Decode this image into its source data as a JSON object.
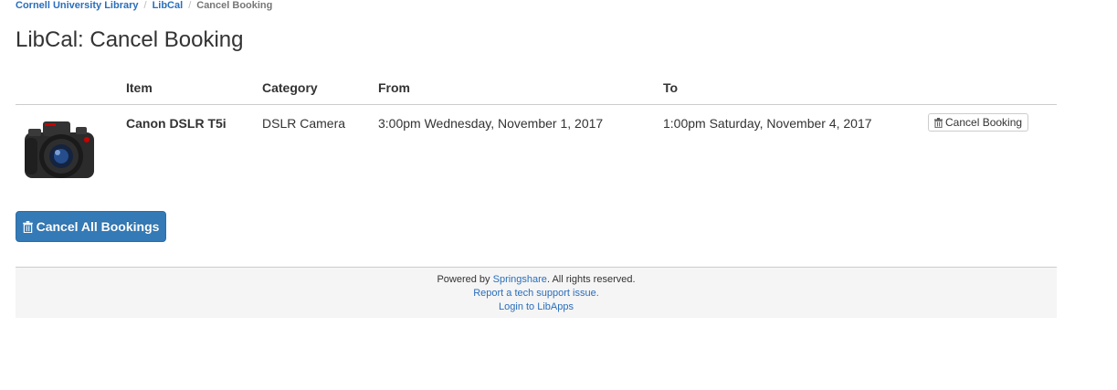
{
  "breadcrumb": {
    "items": [
      "Cornell University Library",
      "LibCal"
    ],
    "current": "Cancel Booking"
  },
  "page_title": "LibCal: Cancel Booking",
  "table": {
    "headers": {
      "item": "Item",
      "category": "Category",
      "from": "From",
      "to": "To"
    },
    "rows": [
      {
        "image": "camera-image",
        "item": "Canon DSLR T5i",
        "category": "DSLR Camera",
        "from": "3:00pm Wednesday, November 1, 2017",
        "to": "1:00pm Saturday, November 4, 2017",
        "action": "Cancel Booking"
      }
    ]
  },
  "cancel_all_label": "Cancel All Bookings",
  "footer": {
    "powered_prefix": "Powered by",
    "powered_link": "Springshare",
    "powered_suffix": ". All rights reserved.",
    "support_link": "Report a tech support issue.",
    "login_link": "Login to LibApps"
  },
  "colors": {
    "link": "#2a6ebb",
    "primary": "#337ab7",
    "footer_bg": "#f5f5f5"
  },
  "icons": {
    "trash": "trash-icon"
  }
}
